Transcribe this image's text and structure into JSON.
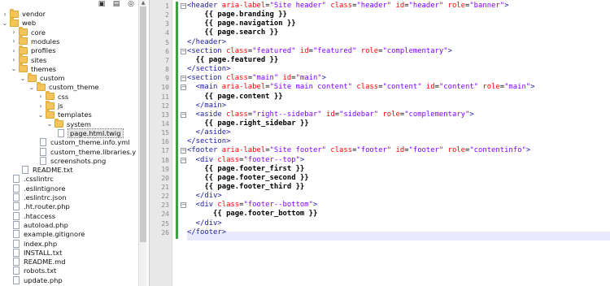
{
  "tree": {
    "items": [
      {
        "label": "vendor",
        "kind": "folder",
        "level": 0,
        "expanded": false
      },
      {
        "label": "web",
        "kind": "folder",
        "level": 0,
        "expanded": true
      },
      {
        "label": "core",
        "kind": "folder",
        "level": 1,
        "expanded": false
      },
      {
        "label": "modules",
        "kind": "folder",
        "level": 1,
        "expanded": false
      },
      {
        "label": "profiles",
        "kind": "folder",
        "level": 1,
        "expanded": false
      },
      {
        "label": "sites",
        "kind": "folder",
        "level": 1,
        "expanded": false
      },
      {
        "label": "themes",
        "kind": "folder",
        "level": 1,
        "expanded": true
      },
      {
        "label": "custom",
        "kind": "folder",
        "level": 2,
        "expanded": true
      },
      {
        "label": "custom_theme",
        "kind": "folder",
        "level": 3,
        "expanded": true
      },
      {
        "label": "css",
        "kind": "folder",
        "level": 4,
        "expanded": false
      },
      {
        "label": "js",
        "kind": "folder",
        "level": 4,
        "expanded": false
      },
      {
        "label": "templates",
        "kind": "folder",
        "level": 4,
        "expanded": true
      },
      {
        "label": "system",
        "kind": "folder",
        "level": 5,
        "expanded": true
      },
      {
        "label": "page.html.twig",
        "kind": "file",
        "level": 6,
        "selected": true
      },
      {
        "label": "custom_theme.info.yml",
        "kind": "file",
        "level": 4
      },
      {
        "label": "custom_theme.libraries.yml",
        "kind": "file",
        "level": 4
      },
      {
        "label": "screenshots.png",
        "kind": "file",
        "level": 4
      },
      {
        "label": "README.txt",
        "kind": "file",
        "level": 2
      },
      {
        "label": ".csslintrc",
        "kind": "file",
        "level": 1
      },
      {
        "label": ".eslintignore",
        "kind": "file",
        "level": 1
      },
      {
        "label": ".eslintrc.json",
        "kind": "file",
        "level": 1
      },
      {
        "label": ".ht.router.php",
        "kind": "file",
        "level": 1
      },
      {
        "label": ".htaccess",
        "kind": "file",
        "level": 1
      },
      {
        "label": "autoload.php",
        "kind": "file",
        "level": 1
      },
      {
        "label": "example.gitignore",
        "kind": "file",
        "level": 1
      },
      {
        "label": "index.php",
        "kind": "file",
        "level": 1
      },
      {
        "label": "INSTALL.txt",
        "kind": "file",
        "level": 1
      },
      {
        "label": "README.md",
        "kind": "file",
        "level": 1
      },
      {
        "label": "robots.txt",
        "kind": "file",
        "level": 1
      },
      {
        "label": "update.php",
        "kind": "file",
        "level": 1
      }
    ]
  },
  "editor": {
    "lines": [
      [
        {
          "t": "<header ",
          "c": "tag"
        },
        {
          "t": "aria-label",
          "c": "attr"
        },
        {
          "t": "=",
          "c": "eq"
        },
        {
          "t": "\"Site header\"",
          "c": "val"
        },
        {
          "t": " class",
          "c": "attr"
        },
        {
          "t": "=",
          "c": "eq"
        },
        {
          "t": "\"header\"",
          "c": "val"
        },
        {
          "t": " id",
          "c": "attr"
        },
        {
          "t": "=",
          "c": "eq"
        },
        {
          "t": "\"header\"",
          "c": "val"
        },
        {
          "t": " role",
          "c": "attr"
        },
        {
          "t": "=",
          "c": "eq"
        },
        {
          "t": "\"banner\"",
          "c": "val"
        },
        {
          "t": ">",
          "c": "tag"
        }
      ],
      [
        {
          "t": "    {{ page.branding }}",
          "c": "tw"
        }
      ],
      [
        {
          "t": "    {{ page.navigation }}",
          "c": "tw"
        }
      ],
      [
        {
          "t": "    {{ page.search }}",
          "c": "tw"
        }
      ],
      [
        {
          "t": "</header>",
          "c": "tag"
        }
      ],
      [
        {
          "t": "<section ",
          "c": "tag"
        },
        {
          "t": "class",
          "c": "attr"
        },
        {
          "t": "=",
          "c": "eq"
        },
        {
          "t": "\"featured\"",
          "c": "val"
        },
        {
          "t": " id",
          "c": "attr"
        },
        {
          "t": "=",
          "c": "eq"
        },
        {
          "t": "\"featured\"",
          "c": "val"
        },
        {
          "t": " role",
          "c": "attr"
        },
        {
          "t": "=",
          "c": "eq"
        },
        {
          "t": "\"complementary\"",
          "c": "val"
        },
        {
          "t": ">",
          "c": "tag"
        }
      ],
      [
        {
          "t": "  {{ page.featured }}",
          "c": "tw"
        }
      ],
      [
        {
          "t": "</section>",
          "c": "tag"
        }
      ],
      [
        {
          "t": "<section ",
          "c": "tag"
        },
        {
          "t": "class",
          "c": "attr"
        },
        {
          "t": "=",
          "c": "eq"
        },
        {
          "t": "\"main\"",
          "c": "val"
        },
        {
          "t": " id",
          "c": "attr"
        },
        {
          "t": "=",
          "c": "eq"
        },
        {
          "t": "\"main\"",
          "c": "val"
        },
        {
          "t": ">",
          "c": "tag"
        }
      ],
      [
        {
          "t": "  <main ",
          "c": "tag"
        },
        {
          "t": "aria-label",
          "c": "attr"
        },
        {
          "t": "=",
          "c": "eq"
        },
        {
          "t": "\"Site main content\"",
          "c": "val"
        },
        {
          "t": " class",
          "c": "attr"
        },
        {
          "t": "=",
          "c": "eq"
        },
        {
          "t": "\"content\"",
          "c": "val"
        },
        {
          "t": " id",
          "c": "attr"
        },
        {
          "t": "=",
          "c": "eq"
        },
        {
          "t": "\"content\"",
          "c": "val"
        },
        {
          "t": " role",
          "c": "attr"
        },
        {
          "t": "=",
          "c": "eq"
        },
        {
          "t": "\"main\"",
          "c": "val"
        },
        {
          "t": ">",
          "c": "tag"
        }
      ],
      [
        {
          "t": "    {{ page.content }}",
          "c": "tw"
        }
      ],
      [
        {
          "t": "  </main>",
          "c": "tag"
        }
      ],
      [
        {
          "t": "  <aside ",
          "c": "tag"
        },
        {
          "t": "class",
          "c": "attr"
        },
        {
          "t": "=",
          "c": "eq"
        },
        {
          "t": "\"right--sidebar\"",
          "c": "val"
        },
        {
          "t": " id",
          "c": "attr"
        },
        {
          "t": "=",
          "c": "eq"
        },
        {
          "t": "\"sidebar\"",
          "c": "val"
        },
        {
          "t": " role",
          "c": "attr"
        },
        {
          "t": "=",
          "c": "eq"
        },
        {
          "t": "\"complementary\"",
          "c": "val"
        },
        {
          "t": ">",
          "c": "tag"
        }
      ],
      [
        {
          "t": "    {{ page.right_sidebar }}",
          "c": "tw"
        }
      ],
      [
        {
          "t": "  </aside>",
          "c": "tag"
        }
      ],
      [
        {
          "t": "</section>",
          "c": "tag"
        }
      ],
      [
        {
          "t": "<footer ",
          "c": "tag"
        },
        {
          "t": "aria-label",
          "c": "attr"
        },
        {
          "t": "=",
          "c": "eq"
        },
        {
          "t": "\"Site footer\"",
          "c": "val"
        },
        {
          "t": " class",
          "c": "attr"
        },
        {
          "t": "=",
          "c": "eq"
        },
        {
          "t": "\"footer\"",
          "c": "val"
        },
        {
          "t": " id",
          "c": "attr"
        },
        {
          "t": "=",
          "c": "eq"
        },
        {
          "t": "\"footer\"",
          "c": "val"
        },
        {
          "t": " role",
          "c": "attr"
        },
        {
          "t": "=",
          "c": "eq"
        },
        {
          "t": "\"contentinfo\"",
          "c": "val"
        },
        {
          "t": ">",
          "c": "tag"
        }
      ],
      [
        {
          "t": "  <div ",
          "c": "tag"
        },
        {
          "t": "class",
          "c": "attr"
        },
        {
          "t": "=",
          "c": "eq"
        },
        {
          "t": "\"footer--top\"",
          "c": "val"
        },
        {
          "t": ">",
          "c": "tag"
        }
      ],
      [
        {
          "t": "    {{ page.footer_first }}",
          "c": "tw"
        }
      ],
      [
        {
          "t": "    {{ page.footer_second }}",
          "c": "tw"
        }
      ],
      [
        {
          "t": "    {{ page.footer_third }}",
          "c": "tw"
        }
      ],
      [
        {
          "t": "  </div>",
          "c": "tag"
        }
      ],
      [
        {
          "t": "  <div ",
          "c": "tag"
        },
        {
          "t": "class",
          "c": "attr"
        },
        {
          "t": "=",
          "c": "eq"
        },
        {
          "t": "\"footer--bottom\"",
          "c": "val"
        },
        {
          "t": ">",
          "c": "tag"
        }
      ],
      [
        {
          "t": "      {{ page.footer_bottom }}",
          "c": "tw"
        }
      ],
      [
        {
          "t": "  </div>",
          "c": "tag"
        }
      ],
      [
        {
          "t": "</footer>",
          "c": "tag"
        }
      ]
    ],
    "fold_lines": [
      1,
      6,
      9,
      10,
      13,
      17,
      18,
      23
    ]
  }
}
